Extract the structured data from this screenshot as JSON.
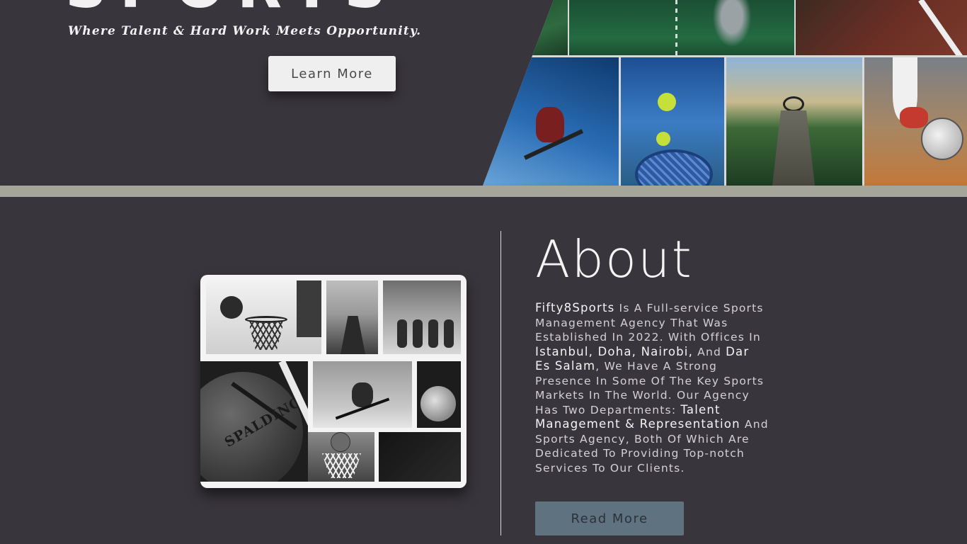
{
  "hero": {
    "title_partial": "SPORTS",
    "tagline": "Where Talent & Hard Work Meets Opportunity.",
    "learn_more_label": "Learn More"
  },
  "about": {
    "title": "About",
    "brand": "Fifty8Sports",
    "text_1": " Is A Full-service Sports Management Agency That Was Established In 2022. With Offices In ",
    "cities_1": "Istanbul, Doha, Nairobi,",
    "text_2": " And ",
    "cities_2": "Dar Es Salam",
    "text_3": ", We Have A Strong Presence In Some Of The Key Sports Markets In The World. Our Agency Has Two Departments: ",
    "departments": "Talent Management & Representation",
    "text_4": " And Sports Agency, Both Of Which Are Dedicated To Providing Top-notch Services To Our Clients.",
    "read_more_label": "Read More",
    "collage_ball_brand": "SPALDING"
  },
  "colors": {
    "background": "#39353c",
    "read_more_button": "#5f7280",
    "learn_more_button": "#efefef"
  }
}
